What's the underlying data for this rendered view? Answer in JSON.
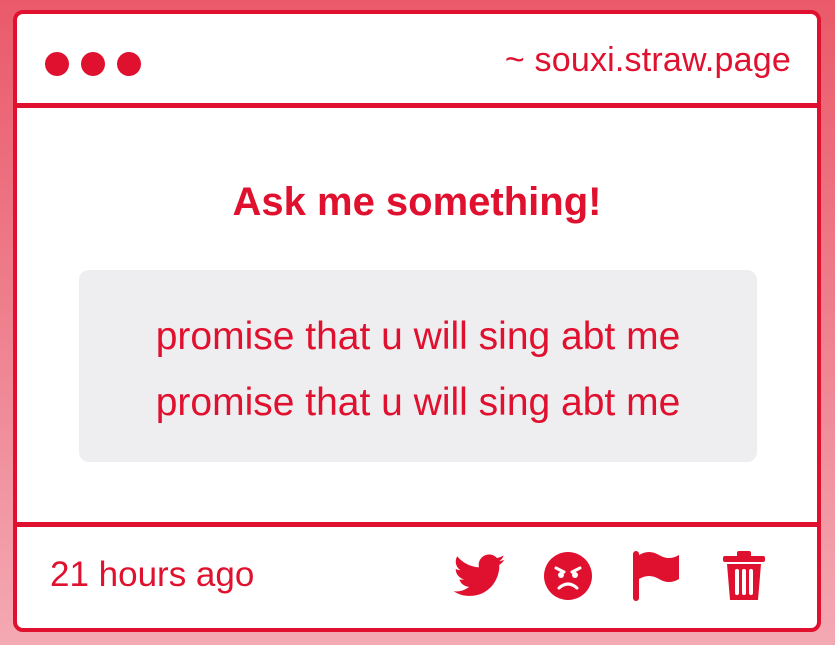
{
  "window": {
    "url": "~ souxi.straw.page"
  },
  "main": {
    "heading": "Ask me something!",
    "question_lines": [
      "promise that u will sing abt me",
      "promise that u will sing abt me"
    ]
  },
  "footer": {
    "timestamp": "21 hours ago",
    "actions": [
      {
        "name": "share-twitter",
        "icon": "twitter-bird-icon"
      },
      {
        "name": "angry-reaction",
        "icon": "angry-face-icon"
      },
      {
        "name": "report",
        "icon": "flag-icon"
      },
      {
        "name": "delete",
        "icon": "trash-icon"
      }
    ]
  },
  "colors": {
    "accent": "#e0102f",
    "card_bg": "#ffffff",
    "question_bg": "#eeedef"
  }
}
